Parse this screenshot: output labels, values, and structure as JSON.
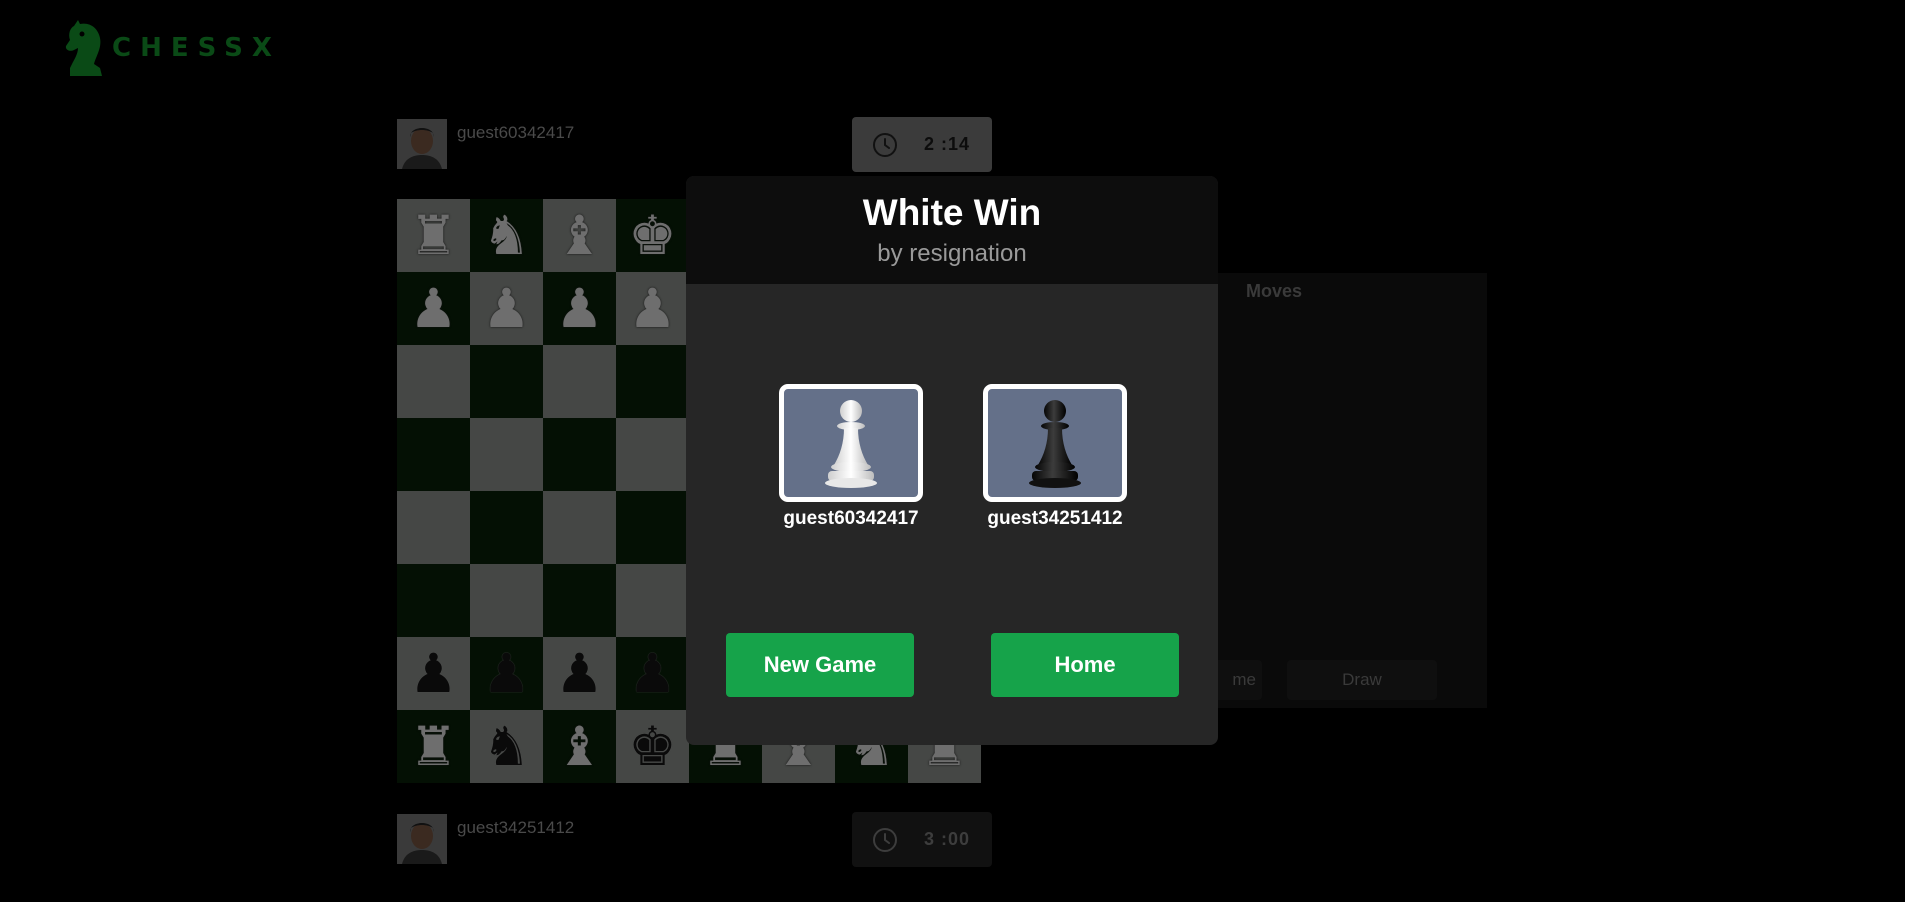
{
  "app": {
    "logo_text": "CHESSX"
  },
  "top_player": {
    "name": "guest60342417",
    "clock": "2 :14"
  },
  "bottom_player": {
    "name": "guest34251412",
    "clock": "3 :00"
  },
  "board": {
    "rows": [
      [
        "♜",
        "♞",
        "♝",
        "♚",
        "",
        "",
        "",
        ""
      ],
      [
        "♟",
        "♟",
        "♟",
        "♟",
        "",
        "",
        "",
        ""
      ],
      [
        "",
        "",
        "",
        "",
        "",
        "",
        "",
        ""
      ],
      [
        "",
        "",
        "",
        "",
        "",
        "",
        "",
        ""
      ],
      [
        "",
        "",
        "",
        "",
        "",
        "",
        "",
        ""
      ],
      [
        "",
        "",
        "",
        "",
        "",
        "",
        "",
        ""
      ],
      [
        "♟",
        "♟",
        "♟",
        "♟",
        "",
        "",
        "",
        ""
      ],
      [
        "♜",
        "♞",
        "♝",
        "♚",
        "♜",
        "♝",
        "♞",
        "♜"
      ]
    ],
    "piece_colors": [
      [
        "w",
        "w",
        "w",
        "w",
        "",
        "",
        "",
        ""
      ],
      [
        "w",
        "w",
        "w",
        "w",
        "",
        "",
        "",
        ""
      ],
      [
        "",
        "",
        "",
        "",
        "",
        "",
        "",
        ""
      ],
      [
        "",
        "",
        "",
        "",
        "",
        "",
        "",
        ""
      ],
      [
        "",
        "",
        "",
        "",
        "",
        "",
        "",
        ""
      ],
      [
        "",
        "",
        "",
        "",
        "",
        "",
        "",
        ""
      ],
      [
        "b",
        "b",
        "b",
        "b",
        "",
        "",
        "",
        ""
      ],
      [
        "w",
        "b",
        "w",
        "b",
        "w",
        "w",
        "w",
        "w"
      ]
    ]
  },
  "moves_panel": {
    "title": "Moves",
    "partial_button": "me",
    "draw_button": "Draw"
  },
  "modal": {
    "title": "White Win",
    "subtitle": "by resignation",
    "white_player": "guest60342417",
    "black_player": "guest34251412",
    "new_game_button": "New Game",
    "home_button": "Home"
  },
  "colors": {
    "accent": "#16a34a",
    "piece_box": "#647089",
    "brand": "#0a4a16"
  }
}
